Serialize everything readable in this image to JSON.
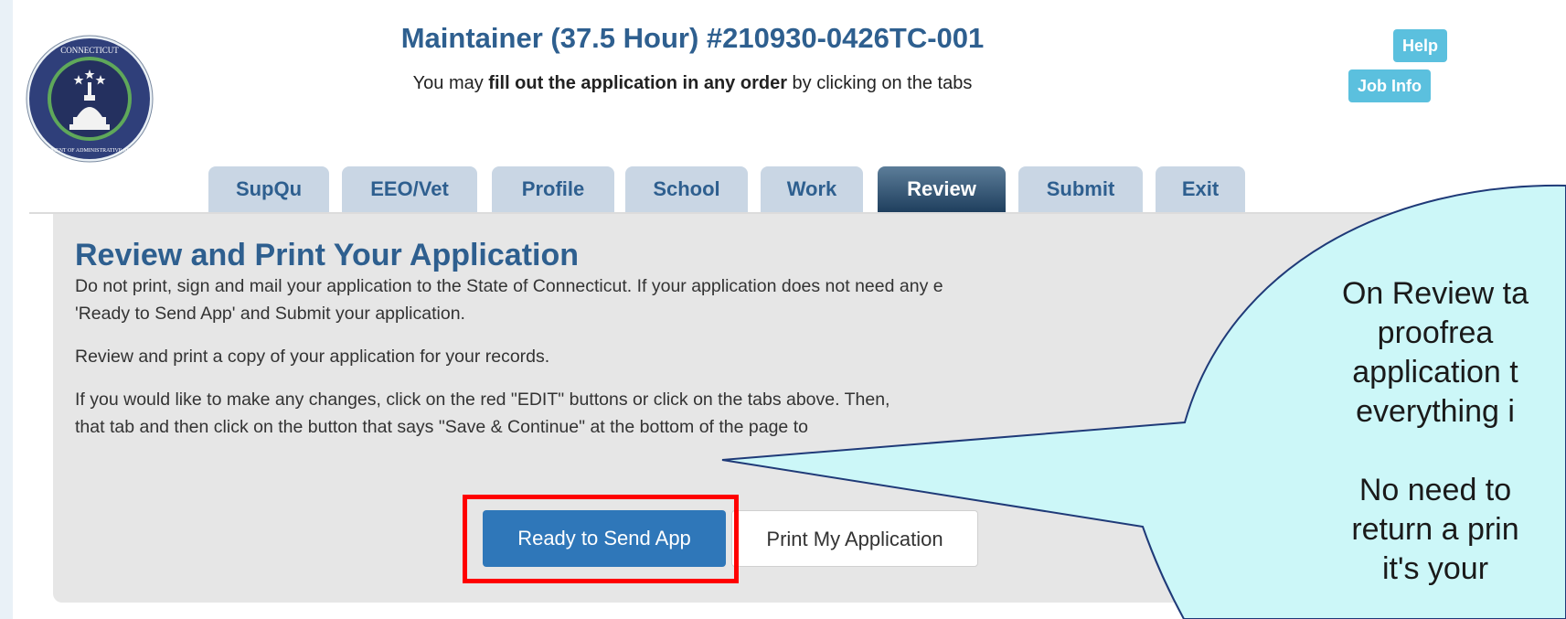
{
  "header": {
    "title": "Maintainer (37.5 Hour) #210930-0426TC-001",
    "subtitle_before": "You may ",
    "subtitle_bold": "fill out the application in any order",
    "subtitle_after": " by clicking on the tabs"
  },
  "side_buttons": {
    "help": "Help",
    "job_info": "Job Info"
  },
  "logo": {
    "top_text": "CONNECTICUT",
    "ring_text": "DEPARTMENT OF ADMINISTRATIVE SERVICES",
    "colors": {
      "ring": "#2f3f7a",
      "inner": "#24305f",
      "rim": "#5fa85a"
    }
  },
  "tabs": [
    {
      "label": "SupQu"
    },
    {
      "label": "EEO/Vet"
    },
    {
      "label": "Profile"
    },
    {
      "label": "School"
    },
    {
      "label": "Work"
    },
    {
      "label": "Review",
      "active": true
    },
    {
      "label": "Submit"
    },
    {
      "label": "Exit"
    }
  ],
  "panel": {
    "heading": "Review and Print Your Application",
    "para1_line1": "Do not print, sign and mail your application to the State of Connecticut. If your application does not need any e",
    "para1_line2": "'Ready to Send App' and Submit your application.",
    "para2": "Review and print a copy of your application for your records.",
    "para3_line1": "If you would like to make any changes, click on the red \"EDIT\" buttons or click on the tabs above. Then,",
    "para3_line2": "that tab and then click on the button that says \"Save & Continue\" at the bottom of the page to",
    "ready_button": "Ready to Send App",
    "print_button": "Print My Application"
  },
  "callout": {
    "line1": "On Review ta",
    "line2": "proofrea",
    "line3": "application t",
    "line4": "everything i",
    "line5": "No need to",
    "line6": "return a prin",
    "line7": "it's your"
  },
  "colors": {
    "title_blue": "#2e5f8f",
    "info_blue": "#5bc0de",
    "primary_button": "#2f77b9",
    "highlight_red": "#ff0000",
    "callout_fill": "#ccf7f8"
  }
}
